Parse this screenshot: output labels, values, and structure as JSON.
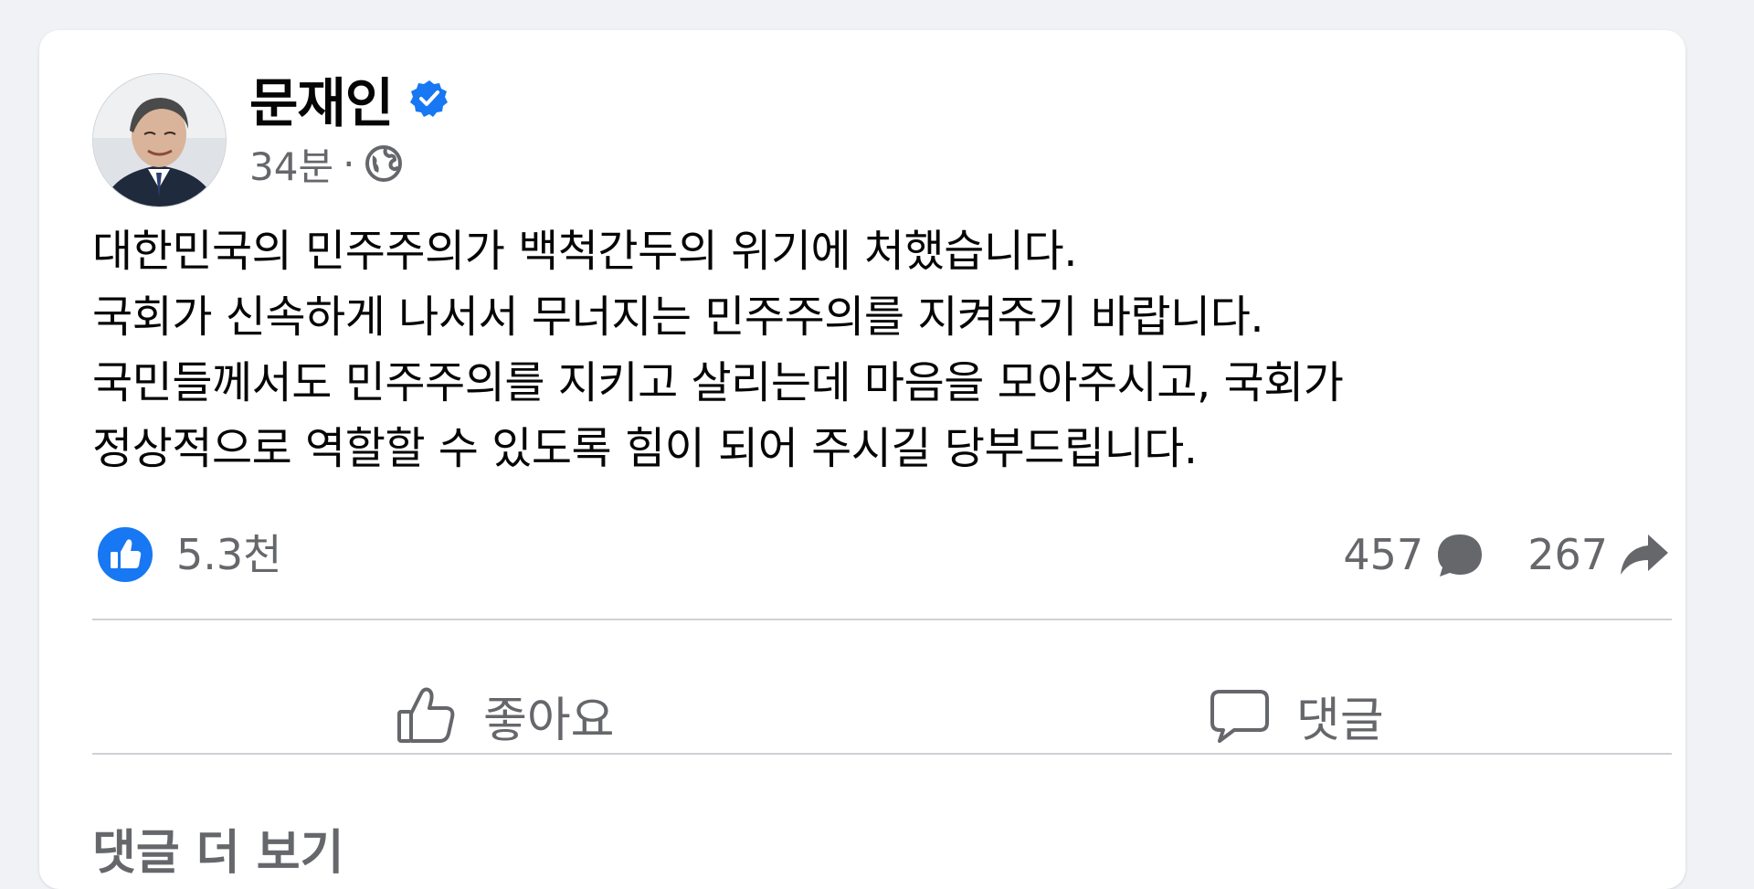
{
  "post": {
    "author": "문재인",
    "time": "34분",
    "separator": "·",
    "privacy_icon": "globe-icon",
    "verified_icon": "verified-badge-icon",
    "lines": [
      "대한민국의 민주주의가 백척간두의 위기에 처했습니다.",
      "국회가 신속하게 나서서 무너지는 민주주의를 지켜주기 바랍니다.",
      "국민들께서도 민주주의를 지키고 살리는데 마음을 모아주시고, 국회가",
      "정상적으로 역할할 수 있도록 힘이 되어 주시길 당부드립니다."
    ]
  },
  "stats": {
    "likes": "5.3천",
    "comments": "457",
    "shares": "267"
  },
  "actions": {
    "like_label": "좋아요",
    "comment_label": "댓글"
  },
  "footer": {
    "more_comments": "댓글 더 보기"
  },
  "colors": {
    "background": "#f0f2f5",
    "card": "#ffffff",
    "brand_blue": "#1877f2",
    "secondary_text": "#65676b",
    "divider": "#ced0d4"
  }
}
